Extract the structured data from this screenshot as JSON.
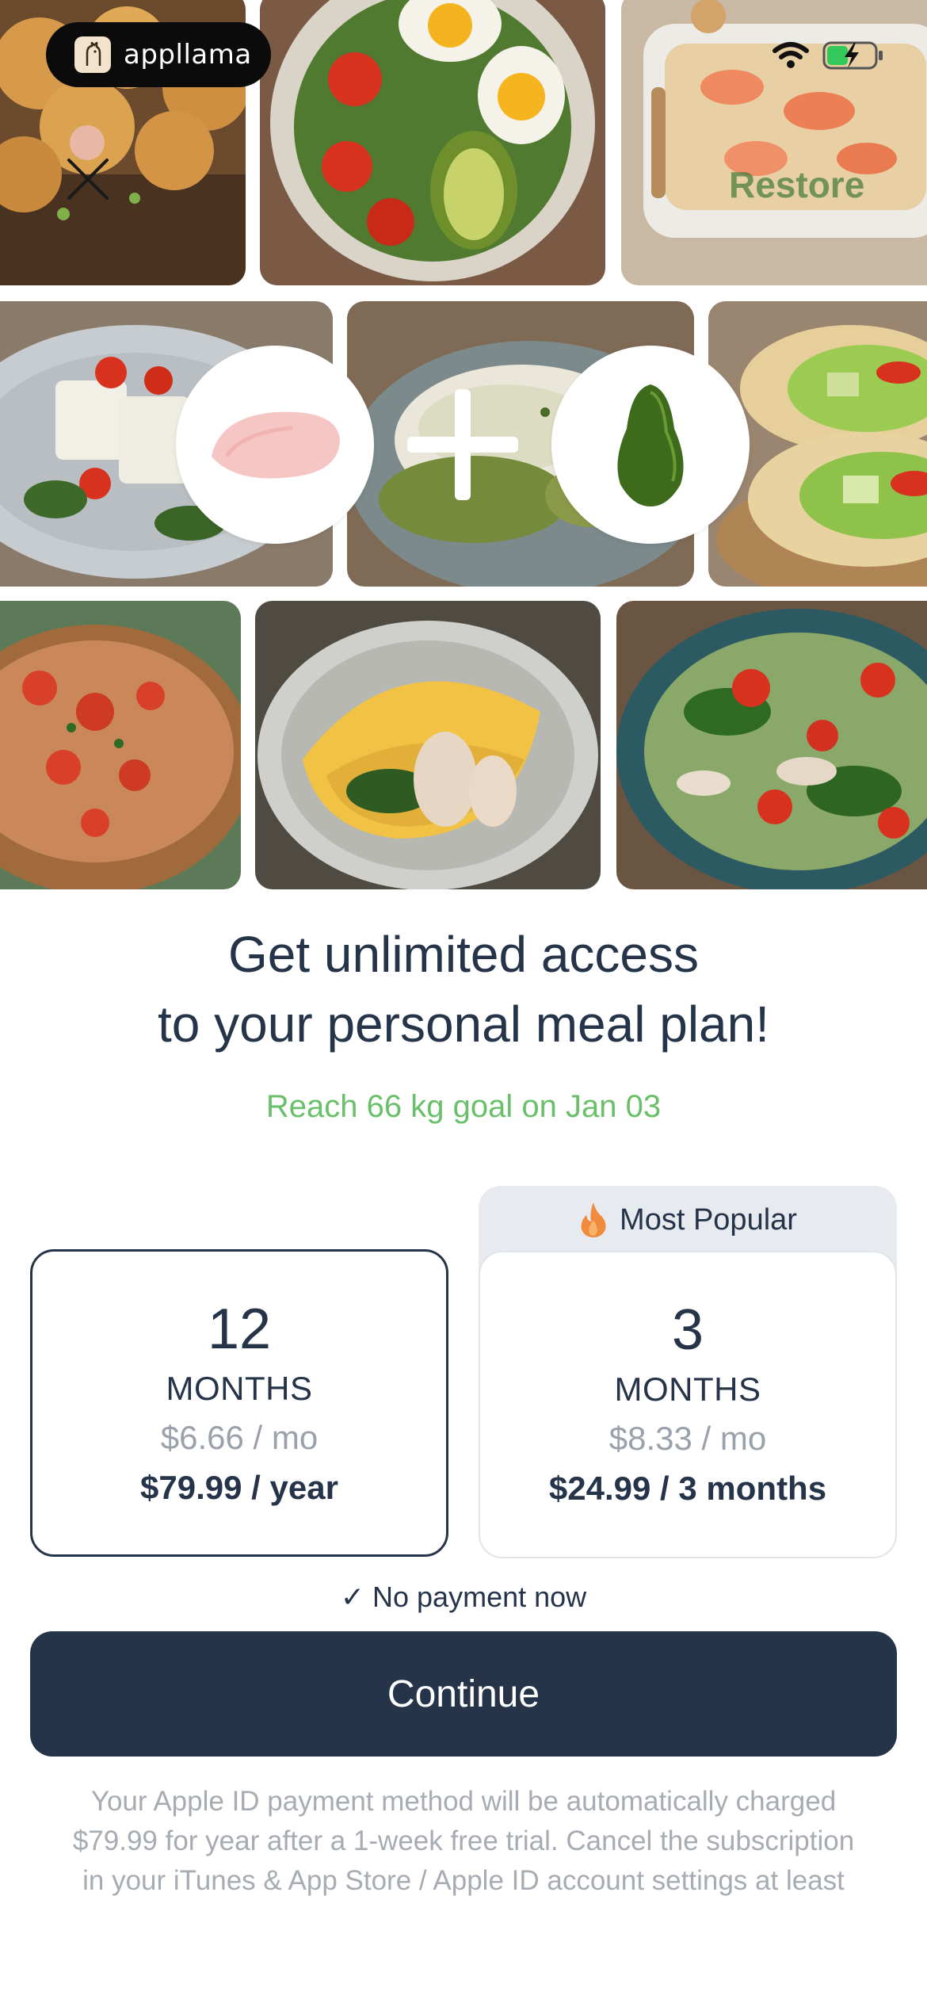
{
  "app": {
    "brand_name": "appllama",
    "restore_label": "Restore"
  },
  "collage": {
    "images": [
      "fried-bites-icon",
      "tomato-avocado-salad-icon",
      "salmon-casserole-icon",
      "tofu-tomato-plate-icon",
      "pesto-chicken-icon",
      "veggie-wrap-icon",
      "bruschetta-icon",
      "chicken-omelette-icon",
      "chicken-spinach-salad-icon"
    ],
    "ingredients": [
      "chicken-breast-icon",
      "plus-icon",
      "avocado-icon"
    ]
  },
  "headline": {
    "line1": "Get unlimited access",
    "line2": "to your personal meal plan!"
  },
  "goal_text": "Reach 66 kg goal on Jan 03",
  "badge": {
    "label": "Most Popular"
  },
  "plans": [
    {
      "number": "12",
      "unit": "MONTHS",
      "per_month": "$6.66 / mo",
      "price": "$79.99 / year",
      "selected": true
    },
    {
      "number": "3",
      "unit": "MONTHS",
      "per_month": "$8.33 / mo",
      "price": "$24.99 / 3 months",
      "selected": false
    }
  ],
  "no_payment": "✓ No payment now",
  "continue_label": "Continue",
  "fine_print": {
    "line1": "Your Apple ID payment method will be automatically charged",
    "line2": "$79.99 for year after a 1-week free trial. Cancel the subscription",
    "line3": "in your iTunes & App Store / Apple ID account settings at least"
  },
  "colors": {
    "primary": "#26344a",
    "goal_green": "#6ac06a",
    "badge_bg": "#e7eaee",
    "muted": "#9aa1ab"
  }
}
